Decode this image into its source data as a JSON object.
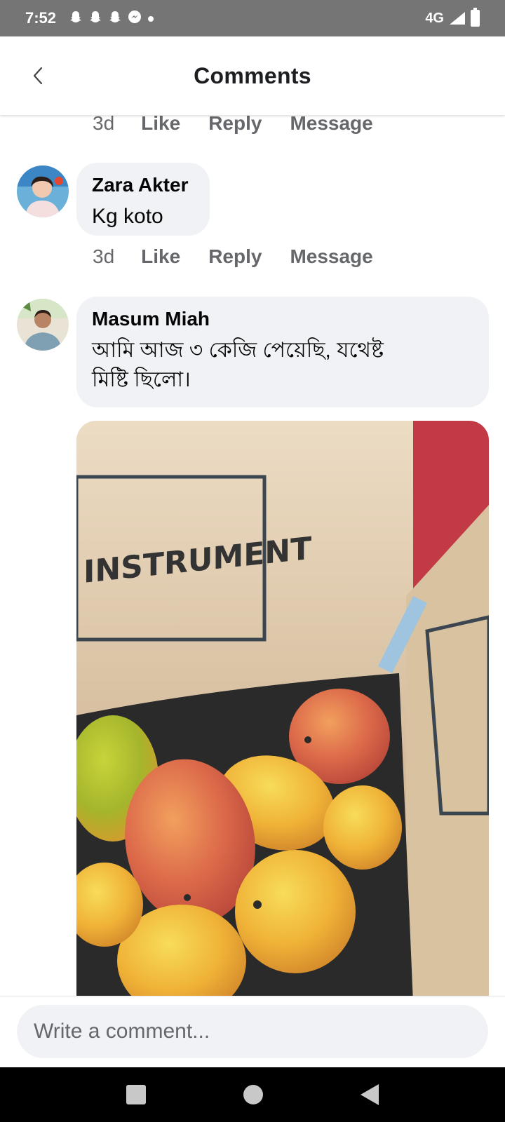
{
  "status_bar": {
    "time": "7:52",
    "left_icons": [
      "snapchat-icon",
      "snapchat-icon",
      "snapchat-icon",
      "messenger-icon",
      "dot-icon"
    ],
    "network": "4G"
  },
  "header": {
    "title": "Comments"
  },
  "comments": [
    {
      "actions": {
        "time": "3d",
        "like": "Like",
        "reply": "Reply",
        "message": "Message"
      }
    },
    {
      "author": "Zara Akter",
      "text": "Kg koto",
      "actions": {
        "time": "3d",
        "like": "Like",
        "reply": "Reply",
        "message": "Message"
      }
    },
    {
      "author": "Masum Miah",
      "text_line1": "আমি আজ ৩ কেজি পেয়েছি, যথেষ্ট",
      "text_line2": "মিষ্টি ছিলো।",
      "photo_label": "INSTRUMENT"
    }
  ],
  "composer": {
    "placeholder": "Write a comment..."
  },
  "colors": {
    "bubble": "#f0f2f5",
    "secondary_text": "#65676b",
    "status_bar": "#757575"
  }
}
